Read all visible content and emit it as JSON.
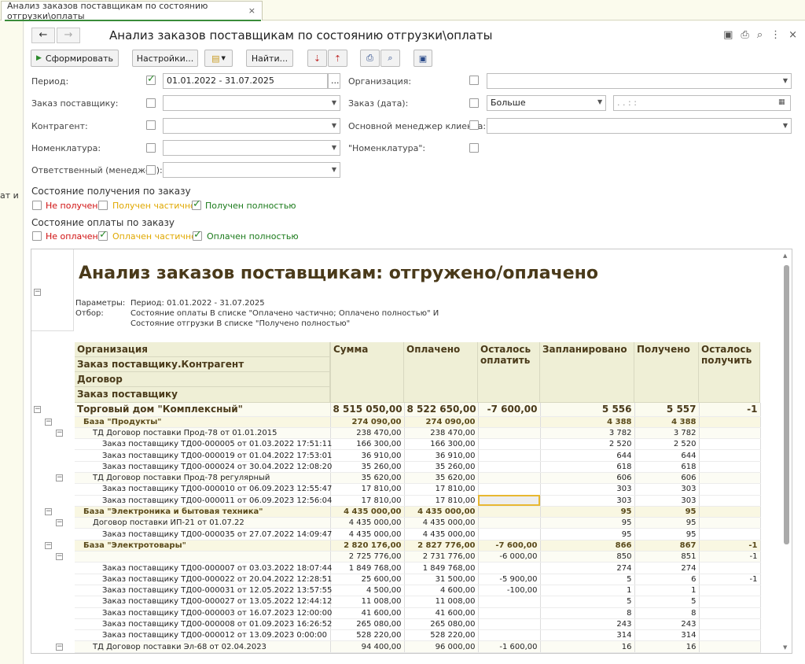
{
  "tab": {
    "title": "Анализ заказов поставщикам по состоянию отгрузки\\оплаты",
    "close": "×"
  },
  "left_strip_text": "ат и",
  "window": {
    "title": "Анализ заказов поставщикам по состоянию отгрузки\\оплаты"
  },
  "toolbar": {
    "generate": "Сформировать",
    "settings": "Настройки...",
    "find": "Найти..."
  },
  "filters": {
    "period_label": "Период:",
    "period_value": "01.01.2022 - 31.07.2025",
    "period_btn": "...",
    "order_label": "Заказ поставщику:",
    "counterparty_label": "Контрагент:",
    "nomenclature_label": "Номенклатура:",
    "responsible_label": "Ответственный (менеджер):",
    "org_label": "Организация:",
    "order_date_label": "Заказ (дата):",
    "order_date_cond": "Больше",
    "order_date_value": ".  .       :  :",
    "manager_label": "Основной менеджер клиента:",
    "nomenclature2_label": "\"Номенклатура\":"
  },
  "receipt_state": {
    "title": "Состояние получения по заказу",
    "options": [
      {
        "label": "Не получен",
        "color": "#d01010",
        "checked": false
      },
      {
        "label": "Получен частично",
        "color": "#e0a800",
        "checked": false
      },
      {
        "label": "Получен полностью",
        "color": "#1a7a1a",
        "checked": true
      }
    ]
  },
  "payment_state": {
    "title": "Состояние оплаты по заказу",
    "options": [
      {
        "label": "Не оплачен",
        "color": "#d01010",
        "checked": false
      },
      {
        "label": "Оплачен частично",
        "color": "#e0a800",
        "checked": true
      },
      {
        "label": "Оплачен полностью",
        "color": "#1a7a1a",
        "checked": true
      }
    ]
  },
  "report": {
    "title": "Анализ заказов поставщикам: отгружено/оплачено",
    "params_key": "Параметры:",
    "params_val": "Период: 01.01.2022 - 31.07.2025",
    "filter_key": "Отбор:",
    "filter_val1": "Состояние оплаты В списке \"Оплачено частично; Оплачено полностью\" И",
    "filter_val2": "Состояние отгрузки В списке \"Получено полностью\"",
    "headers": {
      "g1": "Организация",
      "g2": "Заказ поставщику.Контрагент",
      "g3": "Договор",
      "g4": "Заказ поставщику",
      "sum": "Сумма",
      "paid": "Оплачено",
      "left_pay": "Осталось оплатить",
      "planned": "Запланировано",
      "received": "Получено",
      "left_recv": "Осталось получить"
    },
    "rows": [
      {
        "lvl": 0,
        "name": "Торговый дом \"Комплексный\"",
        "sum": "8 515 050,00",
        "paid": "8 522 650,00",
        "lp": "-7 600,00",
        "plan": "5 556",
        "recv": "5 557",
        "lr": "-1"
      },
      {
        "lvl": 1,
        "name": "База \"Продукты\"",
        "sum": "274 090,00",
        "paid": "274 090,00",
        "lp": "",
        "plan": "4 388",
        "recv": "4 388",
        "lr": ""
      },
      {
        "lvl": 2,
        "name": "ТД Договор поставки Прод-78 от 01.01.2015",
        "sum": "238 470,00",
        "paid": "238 470,00",
        "lp": "",
        "plan": "3 782",
        "recv": "3 782",
        "lr": ""
      },
      {
        "lvl": 3,
        "name": "Заказ поставщику ТД00-000005 от 01.03.2022 17:51:11",
        "sum": "166 300,00",
        "paid": "166 300,00",
        "lp": "",
        "plan": "2 520",
        "recv": "2 520",
        "lr": ""
      },
      {
        "lvl": 3,
        "name": "Заказ поставщику ТД00-000019 от 01.04.2022 17:53:01",
        "sum": "36 910,00",
        "paid": "36 910,00",
        "lp": "",
        "plan": "644",
        "recv": "644",
        "lr": ""
      },
      {
        "lvl": 3,
        "name": "Заказ поставщику ТД00-000024 от 30.04.2022 12:08:20",
        "sum": "35 260,00",
        "paid": "35 260,00",
        "lp": "",
        "plan": "618",
        "recv": "618",
        "lr": ""
      },
      {
        "lvl": 2,
        "name": "ТД Договор поставки Прод-78 регулярный",
        "sum": "35 620,00",
        "paid": "35 620,00",
        "lp": "",
        "plan": "606",
        "recv": "606",
        "lr": ""
      },
      {
        "lvl": 3,
        "name": "Заказ поставщику ТД00-000010 от 06.09.2023 12:55:47",
        "sum": "17 810,00",
        "paid": "17 810,00",
        "lp": "",
        "plan": "303",
        "recv": "303",
        "lr": ""
      },
      {
        "lvl": 3,
        "name": "Заказ поставщику ТД00-000011 от 06.09.2023 12:56:04",
        "sum": "17 810,00",
        "paid": "17 810,00",
        "lp": "",
        "plan": "303",
        "recv": "303",
        "lr": "",
        "sel": true
      },
      {
        "lvl": 1,
        "name": "База \"Электроника и бытовая техника\"",
        "sum": "4 435 000,00",
        "paid": "4 435 000,00",
        "lp": "",
        "plan": "95",
        "recv": "95",
        "lr": ""
      },
      {
        "lvl": 2,
        "name": "Договор поставки ИП-21 от 01.07.22",
        "sum": "4 435 000,00",
        "paid": "4 435 000,00",
        "lp": "",
        "plan": "95",
        "recv": "95",
        "lr": ""
      },
      {
        "lvl": 3,
        "name": "Заказ поставщику ТД00-000035 от 27.07.2022 14:09:47",
        "sum": "4 435 000,00",
        "paid": "4 435 000,00",
        "lp": "",
        "plan": "95",
        "recv": "95",
        "lr": ""
      },
      {
        "lvl": 1,
        "name": "База \"Электротовары\"",
        "sum": "2 820 176,00",
        "paid": "2 827 776,00",
        "lp": "-7 600,00",
        "plan": "866",
        "recv": "867",
        "lr": "-1"
      },
      {
        "lvl": 2,
        "name": "",
        "sum": "2 725 776,00",
        "paid": "2 731 776,00",
        "lp": "-6 000,00",
        "plan": "850",
        "recv": "851",
        "lr": "-1"
      },
      {
        "lvl": 3,
        "name": "Заказ поставщику ТД00-000007 от 03.03.2022 18:07:44",
        "sum": "1 849 768,00",
        "paid": "1 849 768,00",
        "lp": "",
        "plan": "274",
        "recv": "274",
        "lr": ""
      },
      {
        "lvl": 3,
        "name": "Заказ поставщику ТД00-000022 от 20.04.2022 12:28:51",
        "sum": "25 600,00",
        "paid": "31 500,00",
        "lp": "-5 900,00",
        "plan": "5",
        "recv": "6",
        "lr": "-1"
      },
      {
        "lvl": 3,
        "name": "Заказ поставщику ТД00-000031 от 12.05.2022 13:57:55",
        "sum": "4 500,00",
        "paid": "4 600,00",
        "lp": "-100,00",
        "plan": "1",
        "recv": "1",
        "lr": ""
      },
      {
        "lvl": 3,
        "name": "Заказ поставщику ТД00-000027 от 13.05.2022 12:44:12",
        "sum": "11 008,00",
        "paid": "11 008,00",
        "lp": "",
        "plan": "5",
        "recv": "5",
        "lr": ""
      },
      {
        "lvl": 3,
        "name": "Заказ поставщику ТД00-000003 от 16.07.2023 12:00:00",
        "sum": "41 600,00",
        "paid": "41 600,00",
        "lp": "",
        "plan": "8",
        "recv": "8",
        "lr": ""
      },
      {
        "lvl": 3,
        "name": "Заказ поставщику ТД00-000008 от 01.09.2023 16:26:52",
        "sum": "265 080,00",
        "paid": "265 080,00",
        "lp": "",
        "plan": "243",
        "recv": "243",
        "lr": ""
      },
      {
        "lvl": 3,
        "name": "Заказ поставщику ТД00-000012 от 13.09.2023 0:00:00",
        "sum": "528 220,00",
        "paid": "528 220,00",
        "lp": "",
        "plan": "314",
        "recv": "314",
        "lr": ""
      },
      {
        "lvl": 2,
        "name": "ТД Договор поставки Эл-68 от 02.04.2023",
        "sum": "94 400,00",
        "paid": "96 000,00",
        "lp": "-1 600,00",
        "plan": "16",
        "recv": "16",
        "lr": ""
      }
    ]
  }
}
